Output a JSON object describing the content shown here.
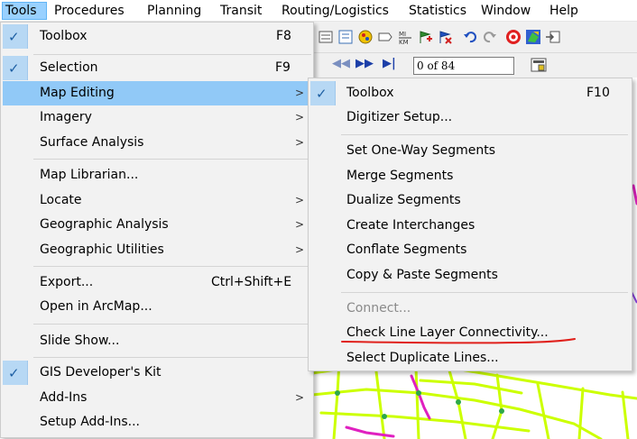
{
  "menubar": {
    "items": [
      "Tools",
      "Procedures",
      "Planning",
      "Transit",
      "Routing/Logistics",
      "Statistics",
      "Window",
      "Help"
    ]
  },
  "tools_menu": {
    "items": [
      {
        "label": "Toolbox",
        "shortcut": "F8",
        "checked": true
      },
      {
        "label": "Selection",
        "shortcut": "F9",
        "checked": true
      },
      {
        "label": "Map Editing",
        "submenu": true,
        "highlighted": true
      },
      {
        "label": "Imagery",
        "submenu": true
      },
      {
        "label": "Surface Analysis",
        "submenu": true
      },
      {
        "label": "Map Librarian..."
      },
      {
        "label": "Locate",
        "submenu": true
      },
      {
        "label": "Geographic Analysis",
        "submenu": true
      },
      {
        "label": "Geographic Utilities",
        "submenu": true
      },
      {
        "label": "Export...",
        "shortcut": "Ctrl+Shift+E"
      },
      {
        "label": "Open in ArcMap..."
      },
      {
        "label": "Slide Show..."
      },
      {
        "label": "GIS Developer's Kit",
        "checked": true
      },
      {
        "label": "Add-Ins",
        "submenu": true
      },
      {
        "label": "Setup Add-Ins..."
      }
    ]
  },
  "map_editing_menu": {
    "items": [
      {
        "label": "Toolbox",
        "shortcut": "F10",
        "checked": true
      },
      {
        "label": "Digitizer Setup..."
      },
      {
        "label": "Set One-Way Segments"
      },
      {
        "label": "Merge Segments"
      },
      {
        "label": "Dualize Segments"
      },
      {
        "label": "Create Interchanges"
      },
      {
        "label": "Conflate Segments"
      },
      {
        "label": "Copy & Paste Segments"
      },
      {
        "label": "Connect...",
        "disabled": true
      },
      {
        "label": "Check Line Layer Connectivity...",
        "annotated": true
      },
      {
        "label": "Select Duplicate Lines..."
      }
    ]
  },
  "toolbar": {
    "nav_prev": "◀◀",
    "nav_next": "▶▶",
    "nav_last": "▶|",
    "record_counter": "0 of 84"
  },
  "colors": {
    "menu_background": "#f2f2f2",
    "highlight": "#91c9f7",
    "annotation_underline": "#e0201b",
    "map_lines": "#ccff00",
    "map_magenta": "#e020c0"
  }
}
